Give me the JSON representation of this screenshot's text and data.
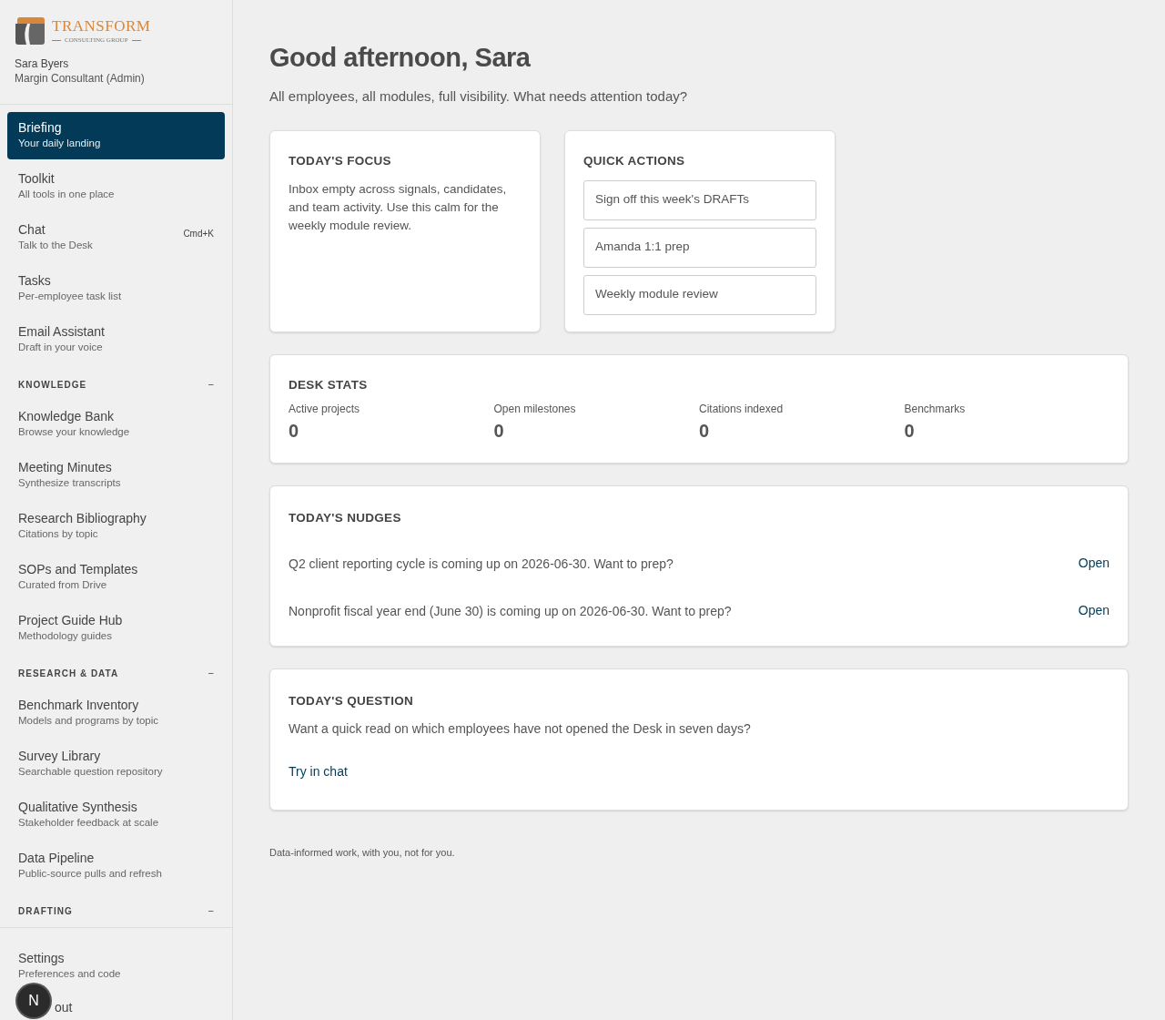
{
  "brand": {
    "name": "TRANSFORM",
    "tagline": "CONSULTING GROUP"
  },
  "user": {
    "name": "Sara Byers",
    "role": "Margin Consultant (Admin)"
  },
  "nav": [
    {
      "kind": "item",
      "title": "Briefing",
      "subtitle": "Your daily landing",
      "selected": true
    },
    {
      "kind": "item",
      "title": "Toolkit",
      "subtitle": "All tools in one place",
      "selected": false
    },
    {
      "kind": "item",
      "title": "Chat",
      "subtitle": "Talk to the Desk",
      "shortcut": "Cmd+K",
      "selected": false
    },
    {
      "kind": "item",
      "title": "Tasks",
      "subtitle": "Per-employee task list",
      "selected": false
    },
    {
      "kind": "item",
      "title": "Email Assistant",
      "subtitle": "Draft in your voice",
      "selected": false
    },
    {
      "kind": "section",
      "label": "KNOWLEDGE",
      "toggle": "−"
    },
    {
      "kind": "item",
      "title": "Knowledge Bank",
      "subtitle": "Browse your knowledge",
      "selected": false
    },
    {
      "kind": "item",
      "title": "Meeting Minutes",
      "subtitle": "Synthesize transcripts",
      "selected": false
    },
    {
      "kind": "item",
      "title": "Research Bibliography",
      "subtitle": "Citations by topic",
      "selected": false
    },
    {
      "kind": "item",
      "title": "SOPs and Templates",
      "subtitle": "Curated from Drive",
      "selected": false
    },
    {
      "kind": "item",
      "title": "Project Guide Hub",
      "subtitle": "Methodology guides",
      "selected": false
    },
    {
      "kind": "section",
      "label": "RESEARCH & DATA",
      "toggle": "−"
    },
    {
      "kind": "item",
      "title": "Benchmark Inventory",
      "subtitle": "Models and programs by topic",
      "selected": false
    },
    {
      "kind": "item",
      "title": "Survey Library",
      "subtitle": "Searchable question repository",
      "selected": false
    },
    {
      "kind": "item",
      "title": "Qualitative Synthesis",
      "subtitle": "Stakeholder feedback at scale",
      "selected": false
    },
    {
      "kind": "item",
      "title": "Data Pipeline",
      "subtitle": "Public-source pulls and refresh",
      "selected": false
    },
    {
      "kind": "section",
      "label": "DRAFTING",
      "toggle": "−"
    }
  ],
  "footer_nav": [
    {
      "title": "Settings",
      "subtitle": "Preferences and code"
    },
    {
      "title": "out"
    }
  ],
  "avatar": {
    "initial": "N"
  },
  "greeting": "Good afternoon, Sara",
  "intro": "All employees, all modules, full visibility. What needs attention today?",
  "focus": {
    "title": "TODAY'S FOCUS",
    "text": "Inbox empty across signals, candidates, and team activity. Use this calm for the weekly module review."
  },
  "quick_actions": {
    "title": "QUICK ACTIONS",
    "buttons": [
      "Sign off this week's DRAFTs",
      "Amanda 1:1 prep",
      "Weekly module review"
    ]
  },
  "desk_stats": {
    "title": "DESK STATS",
    "stats": [
      {
        "label": "Active projects",
        "value": "0"
      },
      {
        "label": "Open milestones",
        "value": "0"
      },
      {
        "label": "Citations indexed",
        "value": "0"
      },
      {
        "label": "Benchmarks",
        "value": "0"
      }
    ]
  },
  "nudges": {
    "title": "TODAY'S NUDGES",
    "items": [
      {
        "text": "Q2 client reporting cycle is coming up on 2026-06-30. Want to prep?",
        "action": "Open"
      },
      {
        "text": "Nonprofit fiscal year end (June 30) is coming up on 2026-06-30. Want to prep?",
        "action": "Open"
      }
    ]
  },
  "question": {
    "title": "TODAY'S QUESTION",
    "text": "Want a quick read on which employees have not opened the Desk in seven days?",
    "action": "Try in chat"
  },
  "footer": "Data-informed work, with you, not for you."
}
